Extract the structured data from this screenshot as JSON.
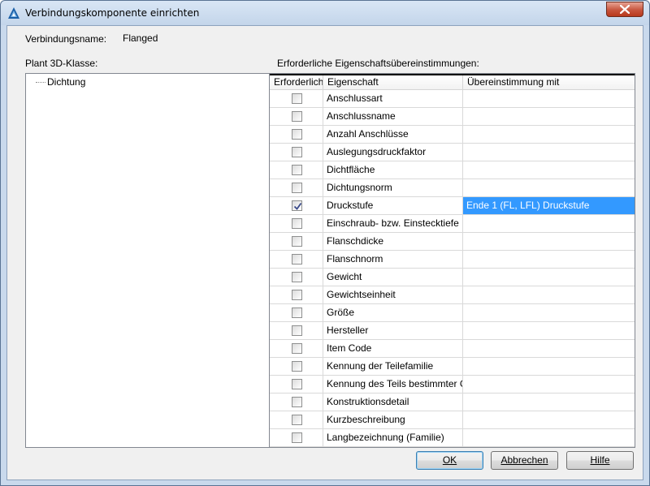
{
  "window": {
    "title": "Verbindungskomponente einrichten"
  },
  "connection": {
    "name_label": "Verbindungsname:",
    "name_value": "Flanged"
  },
  "class_panel": {
    "label": "Plant 3D-Klasse:",
    "tree_items": [
      "Dichtung"
    ]
  },
  "properties_panel": {
    "label": "Erforderliche Eigenschaftsübereinstimmungen:",
    "columns": [
      "Erforderlich",
      "Eigenschaft",
      "Übereinstimmung mit"
    ],
    "rows": [
      {
        "required": false,
        "property": "Anschlussart",
        "match": ""
      },
      {
        "required": false,
        "property": "Anschlussname",
        "match": ""
      },
      {
        "required": false,
        "property": "Anzahl Anschlüsse",
        "match": ""
      },
      {
        "required": false,
        "property": "Auslegungsdruckfaktor",
        "match": ""
      },
      {
        "required": false,
        "property": "Dichtfläche",
        "match": ""
      },
      {
        "required": false,
        "property": "Dichtungsnorm",
        "match": ""
      },
      {
        "required": true,
        "property": "Druckstufe",
        "match": "Ende 1 (FL, LFL) Druckstufe"
      },
      {
        "required": false,
        "property": "Einschraub- bzw. Einstecktiefe",
        "match": ""
      },
      {
        "required": false,
        "property": "Flanschdicke",
        "match": ""
      },
      {
        "required": false,
        "property": "Flanschnorm",
        "match": ""
      },
      {
        "required": false,
        "property": "Gewicht",
        "match": ""
      },
      {
        "required": false,
        "property": "Gewichtseinheit",
        "match": ""
      },
      {
        "required": false,
        "property": "Größe",
        "match": ""
      },
      {
        "required": false,
        "property": "Hersteller",
        "match": ""
      },
      {
        "required": false,
        "property": "Item Code",
        "match": ""
      },
      {
        "required": false,
        "property": "Kennung der Teilefamilie",
        "match": ""
      },
      {
        "required": false,
        "property": "Kennung des Teils bestimmter Gr...",
        "match": ""
      },
      {
        "required": false,
        "property": "Konstruktionsdetail",
        "match": ""
      },
      {
        "required": false,
        "property": "Kurzbeschreibung",
        "match": ""
      },
      {
        "required": false,
        "property": "Langbezeichnung (Familie)",
        "match": ""
      }
    ],
    "selected_row": 6
  },
  "buttons": {
    "ok": "OK",
    "cancel": "Abbrechen",
    "help": "Hilfe"
  },
  "icons": {
    "app": "autocad-plant-icon",
    "close": "close-icon",
    "check": "checkmark-icon"
  },
  "colors": {
    "selection": "#3399ff",
    "close_button": "#c7553d",
    "title_bar": "#c9d9ec"
  }
}
